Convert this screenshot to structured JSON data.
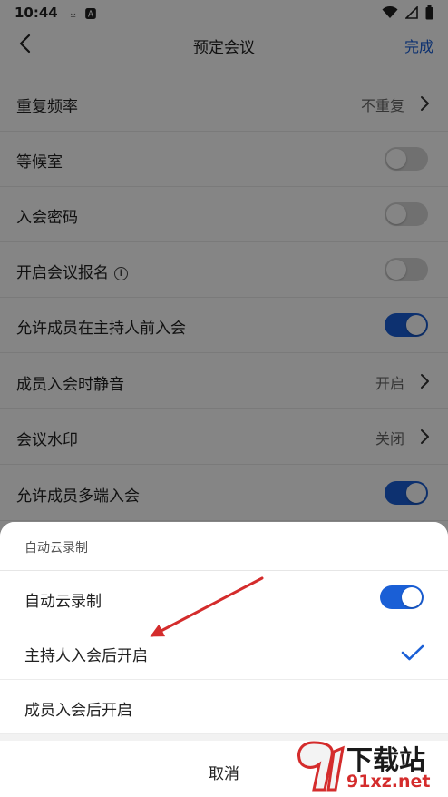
{
  "status_bar": {
    "time": "10:44"
  },
  "header": {
    "title": "预定会议",
    "done_label": "完成"
  },
  "settings": [
    {
      "label": "重复频率",
      "value": "不重复",
      "type": "link"
    },
    {
      "label": "等候室",
      "type": "toggle",
      "enabled": false
    },
    {
      "label": "入会密码",
      "type": "toggle",
      "enabled": false
    },
    {
      "label": "开启会议报名",
      "type": "toggle",
      "enabled": false,
      "has_info_icon": true
    },
    {
      "label": "允许成员在主持人前入会",
      "type": "toggle",
      "enabled": true
    },
    {
      "label": "成员入会时静音",
      "value": "开启",
      "type": "link"
    },
    {
      "label": "会议水印",
      "value": "关闭",
      "type": "link"
    },
    {
      "label": "允许成员多端入会",
      "type": "toggle",
      "enabled": true
    }
  ],
  "sheet": {
    "title": "自动云录制",
    "options": [
      {
        "label": "自动云录制",
        "type": "toggle",
        "enabled": true
      },
      {
        "label": "主持人入会后开启",
        "selected": true
      },
      {
        "label": "成员入会后开启",
        "selected": false
      }
    ],
    "cancel_label": "取消"
  },
  "watermark": {
    "brand": "下载站",
    "domain": "91xz.net"
  },
  "colors": {
    "accent": "#1a5fd6",
    "annotation_arrow": "#d42c2c",
    "overlay": "rgba(0,0,0,0.48)"
  }
}
